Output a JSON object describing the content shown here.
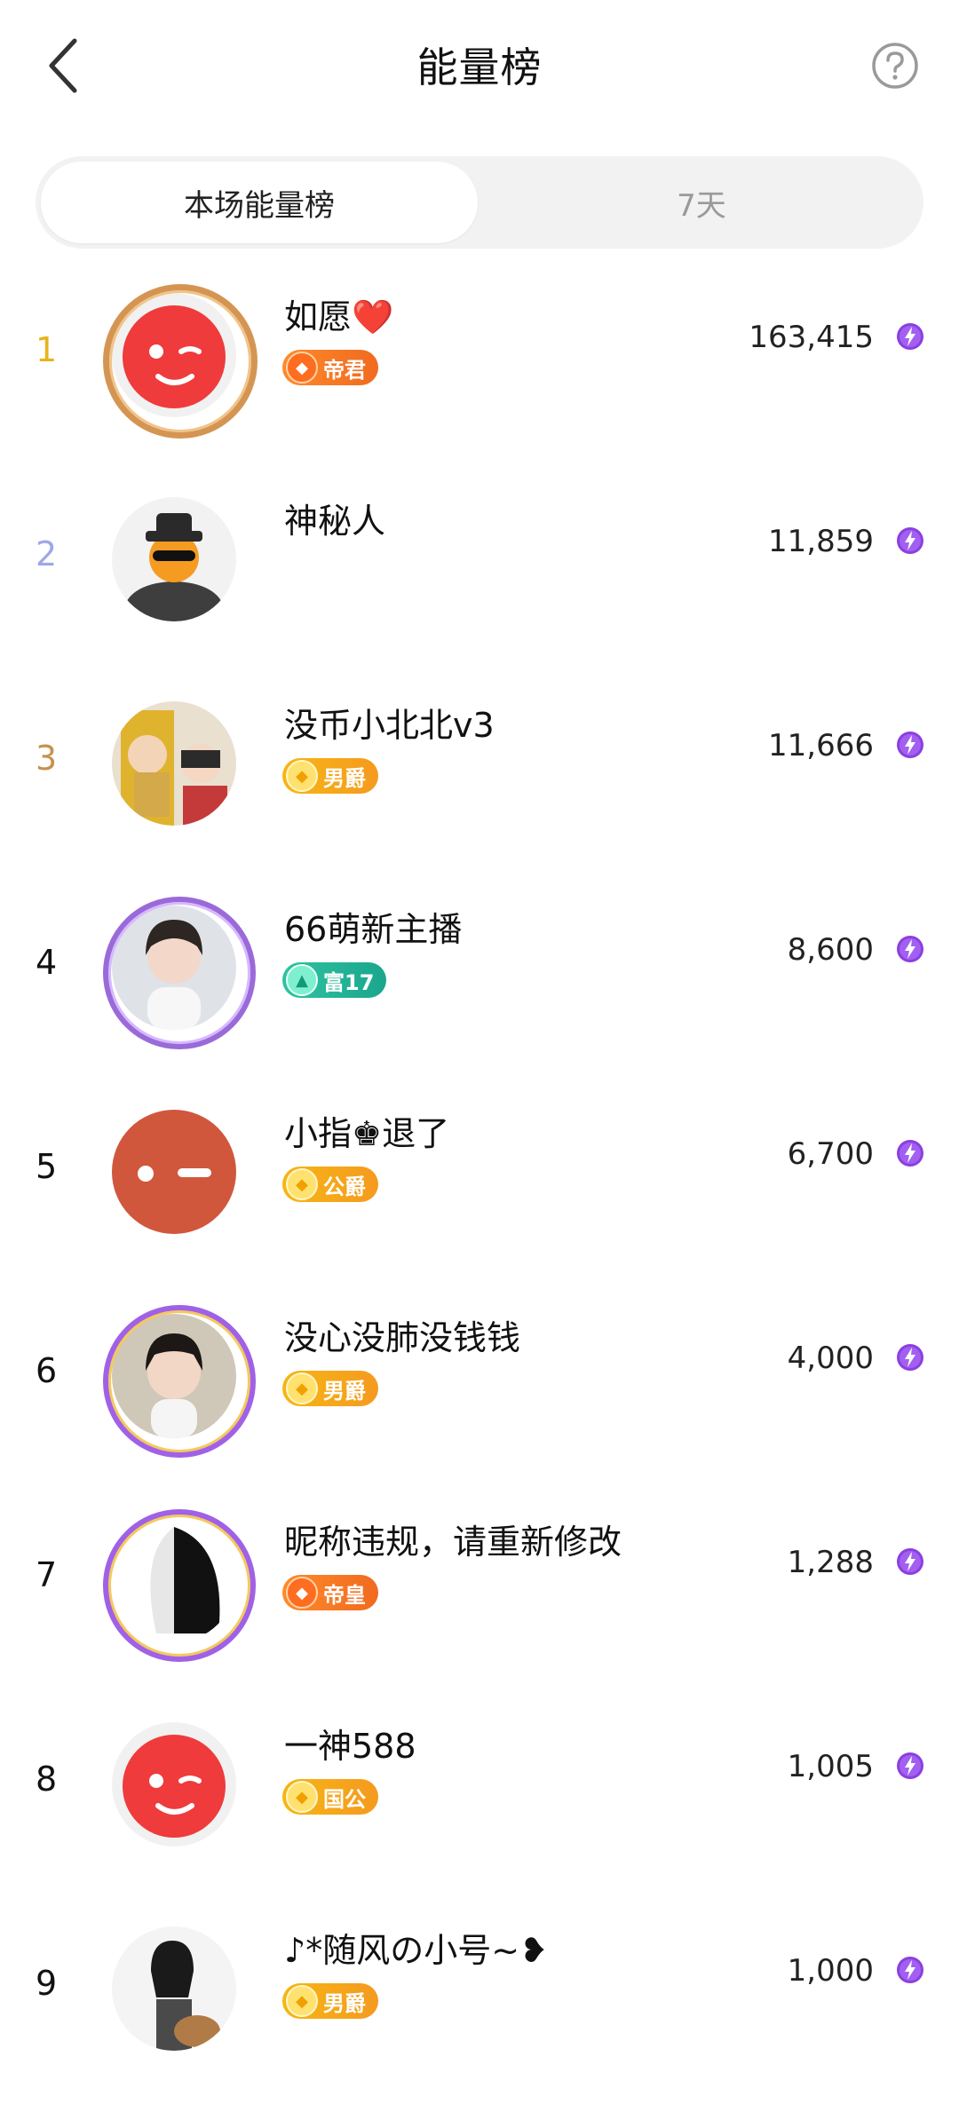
{
  "header": {
    "title": "能量榜"
  },
  "tabs": [
    {
      "label": "本场能量榜",
      "active": true
    },
    {
      "label": "7天",
      "active": false
    }
  ],
  "ranking": [
    {
      "rank": "1",
      "name": "如愿❤️",
      "badge": "帝君",
      "badge_style": "orange",
      "score": "163,415",
      "rank_color": "#e8b21c"
    },
    {
      "rank": "2",
      "name": "神秘人",
      "badge": "",
      "badge_style": "",
      "score": "11,859",
      "rank_color": "#9fa6e8"
    },
    {
      "rank": "3",
      "name": "没币小北北v3",
      "badge": "男爵",
      "badge_style": "gold",
      "score": "11,666",
      "rank_color": "#c7914c"
    },
    {
      "rank": "4",
      "name": "66萌新主播",
      "badge": "富17",
      "badge_style": "teal",
      "score": "8,600",
      "rank_color": "#111111"
    },
    {
      "rank": "5",
      "name": "小指♚退了",
      "badge": "公爵",
      "badge_style": "gold",
      "score": "6,700",
      "rank_color": "#111111"
    },
    {
      "rank": "6",
      "name": "没心没肺没钱钱",
      "badge": "男爵",
      "badge_style": "gold",
      "score": "4,000",
      "rank_color": "#111111"
    },
    {
      "rank": "7",
      "name": "昵称违规，请重新修改",
      "badge": "帝皇",
      "badge_style": "orange",
      "score": "1,288",
      "rank_color": "#111111"
    },
    {
      "rank": "8",
      "name": "一神588",
      "badge": "国公",
      "badge_style": "gold",
      "score": "1,005",
      "rank_color": "#111111"
    },
    {
      "rank": "9",
      "name": "♪*随风の小号~❥",
      "badge": "男爵",
      "badge_style": "gold",
      "score": "1,000",
      "rank_color": "#111111"
    }
  ],
  "colors": {
    "energy": "#8b3fe0",
    "tab_bg": "#f2f2f2"
  }
}
